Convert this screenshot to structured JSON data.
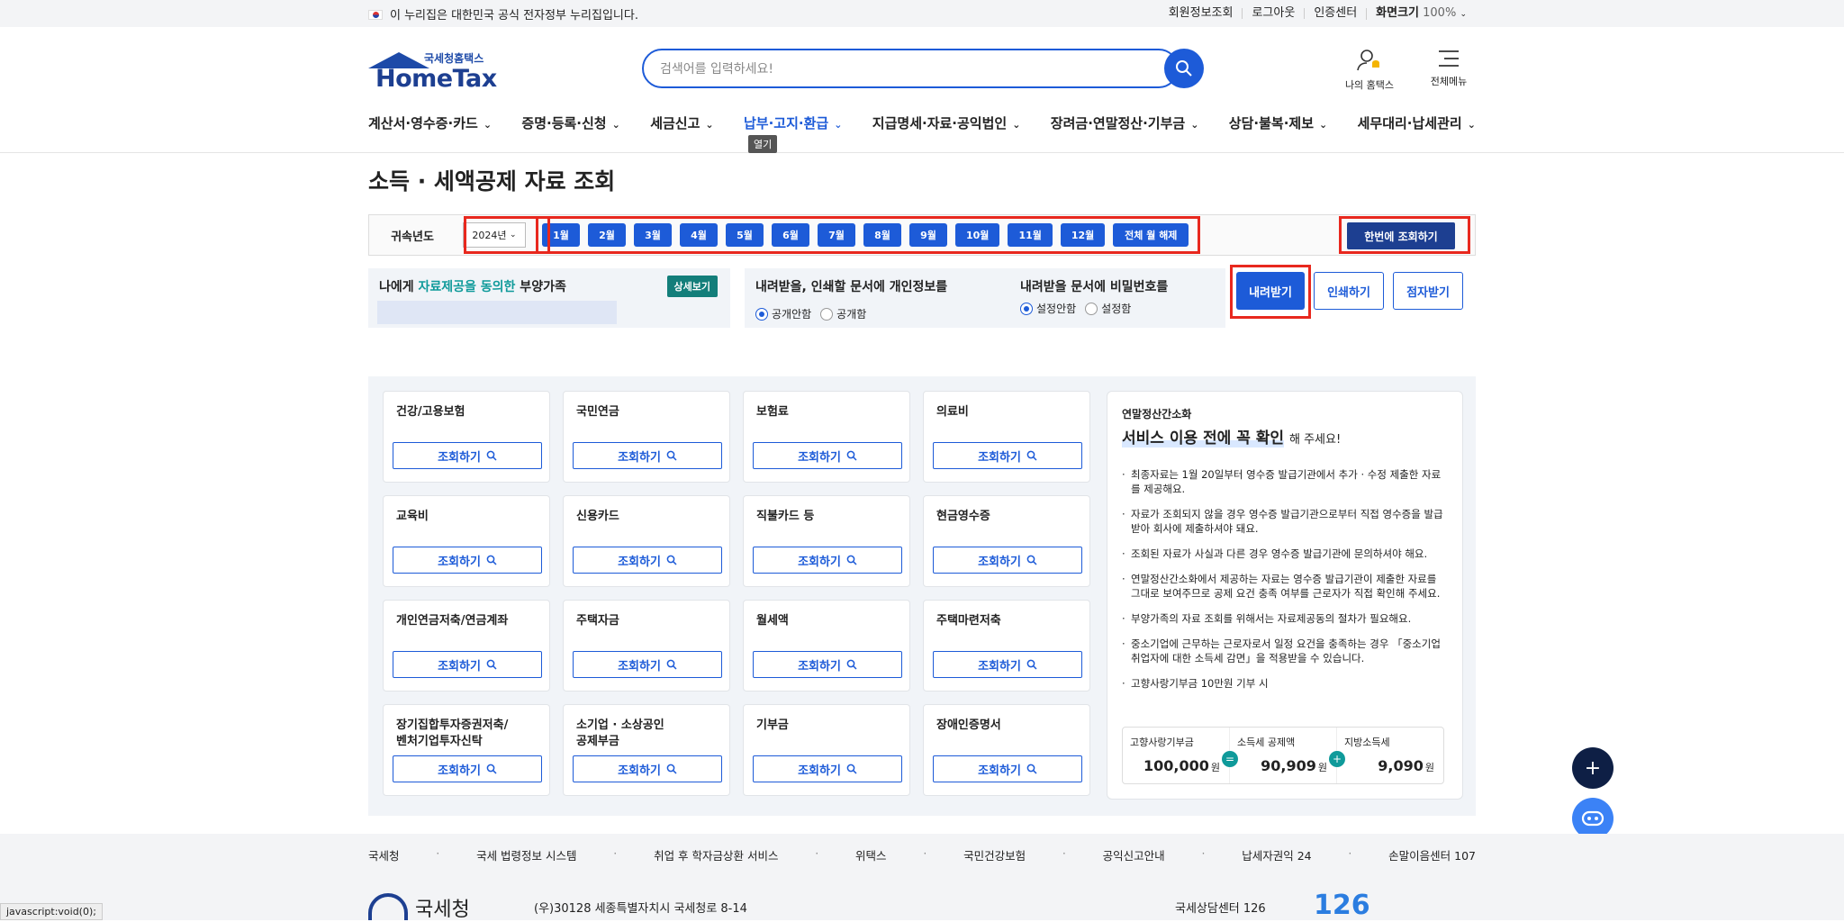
{
  "topbar": {
    "notice": "이 누리집은 대한민국 공식 전자정부 누리집입니다.",
    "links": [
      "회원정보조회",
      "로그아웃",
      "인증센터"
    ],
    "zoom_label": "화면크기",
    "zoom_value": "100%"
  },
  "header": {
    "logo_small": "국세청홈택스",
    "logo_big": "HomeTax",
    "search_placeholder": "검색어를 입력하세요!",
    "my_hometax": "나의 홈택스",
    "all_menu": "전체메뉴"
  },
  "gnb": {
    "items": [
      "계산서·영수증·카드",
      "증명·등록·신청",
      "세금신고",
      "납부·고지·환급",
      "지급명세·자료·공익법인",
      "장려금·연말정산·기부금",
      "상담·불복·제보",
      "세무대리·납세관리"
    ],
    "active_index": 3,
    "tooltip": "열기"
  },
  "page": {
    "title": "소득 · 세액공제 자료 조회"
  },
  "filter": {
    "label": "귀속년도",
    "year": "2024년",
    "months": [
      "1월",
      "2월",
      "3월",
      "4월",
      "5월",
      "6월",
      "7월",
      "8월",
      "9월",
      "10월",
      "11월",
      "12월",
      "전체 월 해제"
    ],
    "all_query": "한번에 조회하기"
  },
  "consent": {
    "prefix": "나에게 ",
    "highlight": "자료제공을 동의한",
    "suffix": " 부양가족",
    "detail": "상세보기"
  },
  "privacy": {
    "label": "내려받을, 인쇄할 문서에 개인정보를",
    "opt1": "공개안함",
    "opt2": "공개함",
    "pw_label": "내려받을 문서에 비밀번호를",
    "pw_opt1": "설정안함",
    "pw_opt2": "설정함"
  },
  "actions": {
    "download": "내려받기",
    "print": "인쇄하기",
    "braille": "점자받기"
  },
  "cards": {
    "query_label": "조회하기",
    "items": [
      "건강/고용보험",
      "국민연금",
      "보험료",
      "의료비",
      "교육비",
      "신용카드",
      "직불카드 등",
      "현금영수증",
      "개인연금저축/연금계좌",
      "주택자금",
      "월세액",
      "주택마련저축",
      "장기집합투자증권저축/\n벤처기업투자신탁",
      "소기업 · 소상공인\n공제부금",
      "기부금",
      "장애인증명서"
    ]
  },
  "info": {
    "sub": "연말정산간소화",
    "head": "서비스 이용 전에 꼭 확인",
    "head_suffix": "해 주세요!",
    "bullets": [
      "최종자료는 1월 20일부터 영수증 발급기관에서 추가 · 수정 제출한 자료를 제공해요.",
      "자료가 조회되지 않을 경우 영수증 발급기관으로부터 직접 영수증을 발급받아 회사에 제출하셔야 돼요.",
      "조회된 자료가 사실과 다른 경우 영수증 발급기관에 문의하셔야 해요.",
      "연말정산간소화에서 제공하는 자료는 영수증 발급기관이 제출한 자료를 그대로 보여주므로 공제 요건 충족 여부를 근로자가 직접 확인해 주세요.",
      "부양가족의 자료 조회를 위해서는 자료제공동의 절차가 필요해요.",
      "중소기업에 근무하는 근로자로서 일정 요건을 충족하는 경우 「중소기업 취업자에 대한 소득세 감면」을 적용받을 수 있습니다.",
      "고향사랑기부금 10만원 기부 시"
    ],
    "calc": [
      {
        "label": "고향사랑기부금",
        "value": "100,000",
        "unit": "원"
      },
      {
        "label": "소득세 공제액",
        "value": "90,909",
        "unit": "원"
      },
      {
        "label": "지방소득세",
        "value": "9,090",
        "unit": "원"
      }
    ],
    "op1": "=",
    "op2": "+"
  },
  "footer": {
    "links": [
      "국세청",
      "국세 법령정보 시스템",
      "취업 후 학자금상환 서비스",
      "위택스",
      "국민건강보험",
      "공익신고안내",
      "납세자권익 24",
      "손말이음센터 107"
    ],
    "org": "국세청",
    "address": "(우)30128 세종특별자치시 국세청로 8-14",
    "center": "국세상담센터 126",
    "num126": "126"
  },
  "status_text": "javascript:void(0);"
}
